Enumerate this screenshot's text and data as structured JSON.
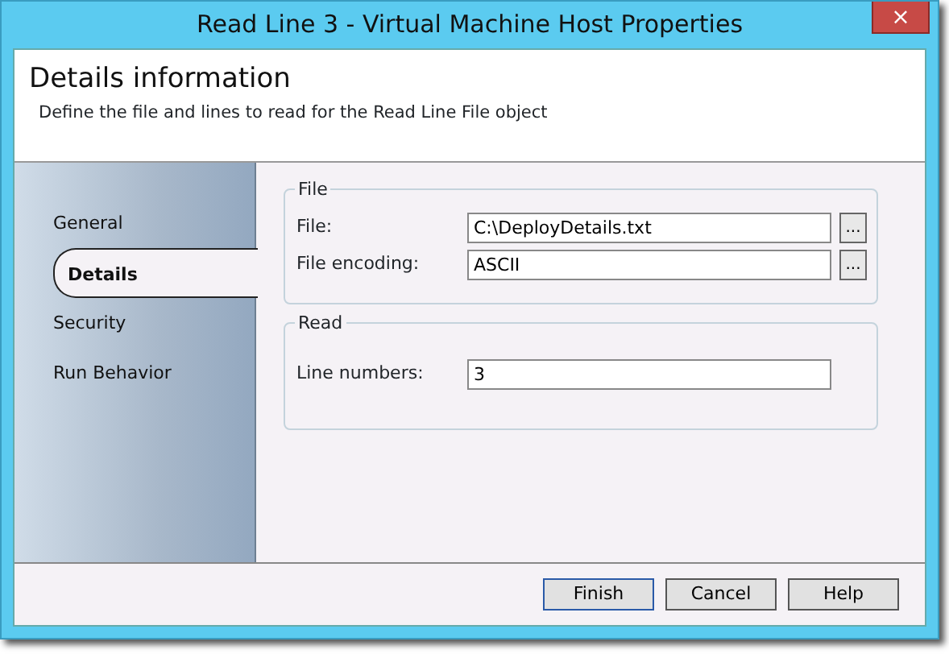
{
  "window": {
    "title": "Read Line 3 - Virtual Machine Host Properties",
    "close": "×"
  },
  "header": {
    "title": "Details information",
    "subtitle": "Define the file and lines to read for the Read Line File object"
  },
  "sidebar": {
    "items": [
      {
        "label": "General",
        "selected": false
      },
      {
        "label": "Details",
        "selected": true
      },
      {
        "label": "Security",
        "selected": false
      },
      {
        "label": "Run Behavior",
        "selected": false
      }
    ]
  },
  "groups": [
    {
      "title": "File",
      "fields": [
        {
          "label": "File:",
          "value": "C:\\DeployDetails.txt",
          "browse": "..."
        },
        {
          "label": "File encoding:",
          "value": "ASCII",
          "browse": "..."
        }
      ]
    },
    {
      "title": "Read",
      "fields": [
        {
          "label": "Line numbers:",
          "value": "3"
        }
      ]
    }
  ],
  "buttons": [
    {
      "label": "Finish",
      "default": true
    },
    {
      "label": "Cancel",
      "default": false
    },
    {
      "label": "Help",
      "default": false
    }
  ]
}
